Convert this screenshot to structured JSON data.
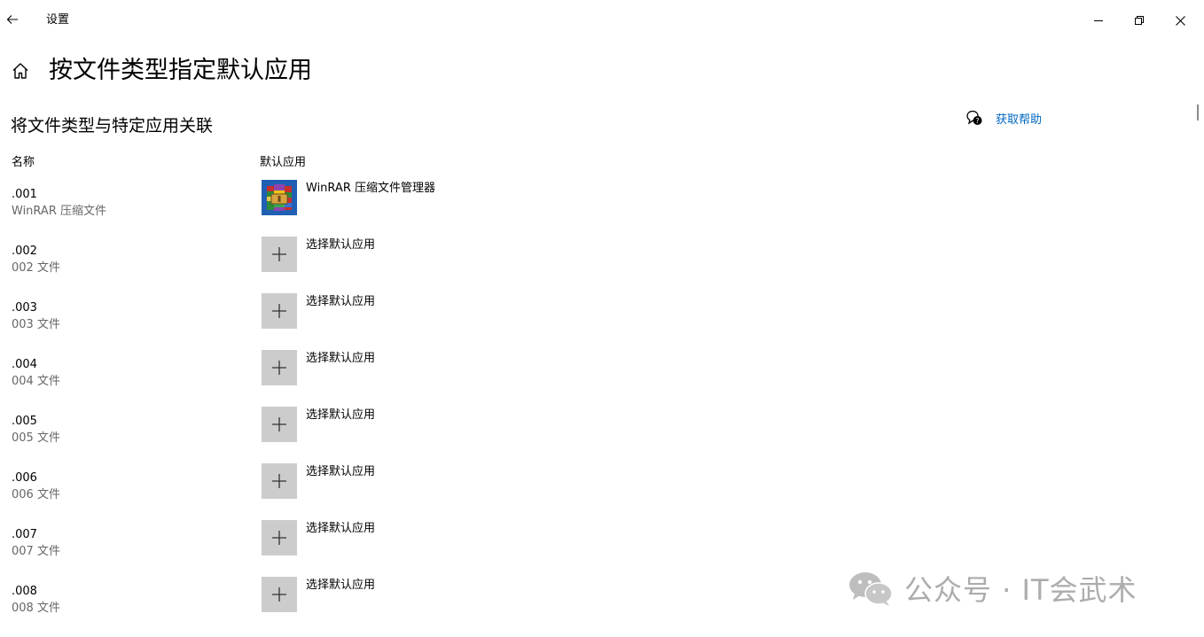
{
  "window": {
    "title": "设置"
  },
  "header": {
    "page_title": "按文件类型指定默认应用",
    "section_title": "将文件类型与特定应用关联"
  },
  "help": {
    "label": "获取帮助"
  },
  "columns": {
    "name": "名称",
    "default_app": "默认应用"
  },
  "rows": [
    {
      "ext": ".001",
      "desc": "WinRAR 压缩文件",
      "app": "WinRAR 压缩文件管理器",
      "icon": "winrar-icon"
    },
    {
      "ext": ".002",
      "desc": "002 文件",
      "app": "选择默认应用",
      "icon": "plus-icon"
    },
    {
      "ext": ".003",
      "desc": "003 文件",
      "app": "选择默认应用",
      "icon": "plus-icon"
    },
    {
      "ext": ".004",
      "desc": "004 文件",
      "app": "选择默认应用",
      "icon": "plus-icon"
    },
    {
      "ext": ".005",
      "desc": "005 文件",
      "app": "选择默认应用",
      "icon": "plus-icon"
    },
    {
      "ext": ".006",
      "desc": "006 文件",
      "app": "选择默认应用",
      "icon": "plus-icon"
    },
    {
      "ext": ".007",
      "desc": "007 文件",
      "app": "选择默认应用",
      "icon": "plus-icon"
    },
    {
      "ext": ".008",
      "desc": "008 文件",
      "app": "选择默认应用",
      "icon": "plus-icon"
    }
  ],
  "watermark": {
    "text": "公众号 · IT会武术"
  },
  "colors": {
    "accent": "#0067c0",
    "tile": "#cccccc",
    "secondary_text": "#666666"
  }
}
